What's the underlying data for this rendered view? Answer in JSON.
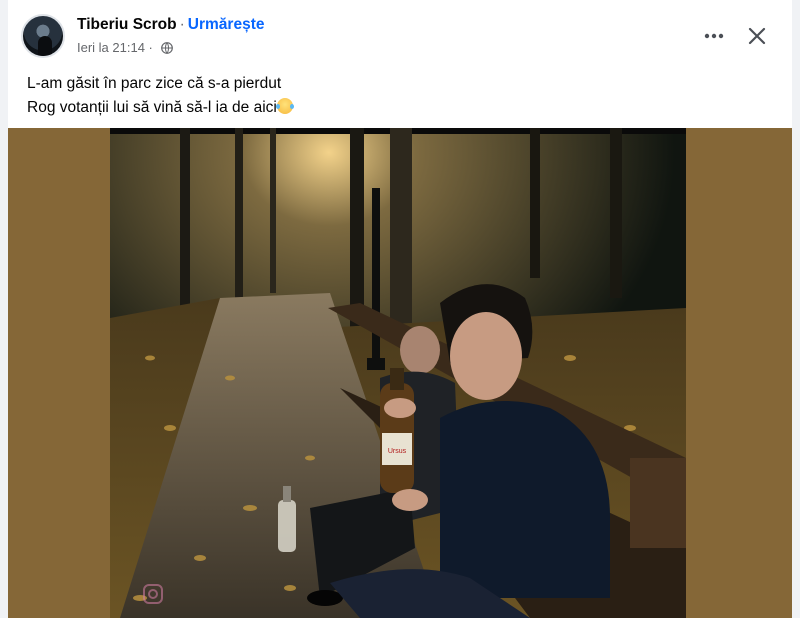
{
  "post": {
    "author": "Tiberiu Scrob",
    "separator": "·",
    "follow_label": "Urmărește",
    "timestamp": "Ieri la 21:14",
    "meta_separator": " · ",
    "audience_icon": "globe-icon",
    "more_icon": "more-options-icon",
    "close_icon": "close-icon",
    "caption_line_1": "L-am găsit în parc zice că s-a pierdut",
    "caption_line_2": "Rog votanții lui să vină să-l ia de aici",
    "caption_emoji": "rolling-on-floor-laughing-emoji"
  },
  "photo": {
    "bottle_label": "Ursus",
    "watermark_icon": "instagram-icon"
  },
  "colors": {
    "follow": "#0866ff",
    "media_background": "#856737",
    "secondary_text": "#65676b"
  }
}
